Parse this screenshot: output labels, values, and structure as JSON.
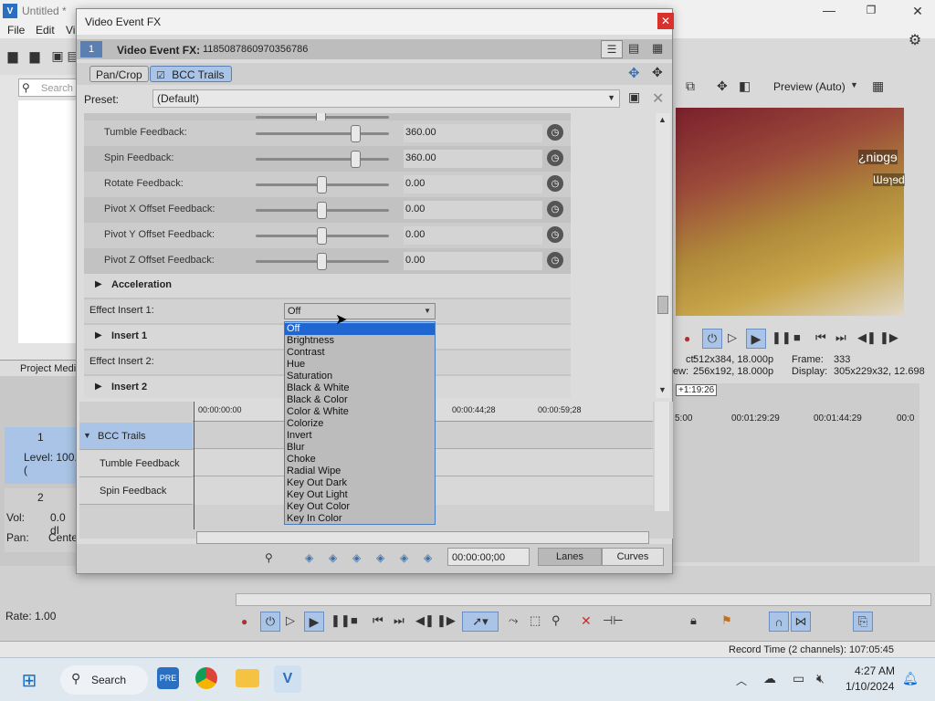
{
  "app": {
    "title": "Untitled *",
    "menu": [
      "File",
      "Edit",
      "Vi"
    ],
    "search_placeholder": "Search",
    "project_media_tab": "Project Medi",
    "track1": {
      "number": "1",
      "level": "Level: 100.("
    },
    "track2": {
      "number": "2",
      "vol_label": "Vol:",
      "vol_value": "0.0 dI",
      "pan_label": "Pan:",
      "pan_value": "Cente"
    },
    "rate": "Rate: 1.00",
    "record_time": "Record Time (2 channels): 107:05:45"
  },
  "preview": {
    "label": "Preview (Auto)",
    "overlay_text_1": "¿niɒgɘ",
    "overlay_text_2": "Ɯɘɿɘd",
    "project_label": "ct:",
    "project_value": "512x384, 18.000p",
    "frame_label": "Frame:",
    "frame_value": "333",
    "preview_label": "ew:",
    "preview_value": "256x192, 18.000p",
    "display_label": "Display:",
    "display_value": "305x229x32, 12.698",
    "timecode_badge": "+1:19:26",
    "ruler": [
      "5:00",
      "00:01:29:29",
      "00:01:44:29",
      "00:0"
    ]
  },
  "dialog": {
    "title": "Video Event FX",
    "header_index": "1",
    "header_text": "Video Event FX:",
    "header_id": "1185087860970356786",
    "chain": [
      "Pan/Crop",
      "BCC Trails"
    ],
    "preset_label": "Preset:",
    "preset_value": "(Default)",
    "params": [
      {
        "label": "Tumble Feedback:",
        "value": "360.00",
        "level": 0.75
      },
      {
        "label": "Spin Feedback:",
        "value": "360.00",
        "level": 0.75
      },
      {
        "label": "Rotate Feedback:",
        "value": "0.00",
        "level": 0.5
      },
      {
        "label": "Pivot X Offset Feedback:",
        "value": "0.00",
        "level": 0.5
      },
      {
        "label": "Pivot Y Offset Feedback:",
        "value": "0.00",
        "level": 0.5
      },
      {
        "label": "Pivot Z Offset Feedback:",
        "value": "0.00",
        "level": 0.5
      }
    ],
    "section_acceleration": "Acceleration",
    "effect_insert_1": "Effect Insert 1:",
    "section_insert_1": "Insert 1",
    "effect_insert_2": "Effect Insert 2:",
    "section_insert_2": "Insert 2",
    "dropdown_value": "Off",
    "dropdown_options": [
      "Off",
      "Brightness",
      "Contrast",
      "Hue",
      "Saturation",
      "Black & White",
      "Black & Color",
      "Color & White",
      "Colorize",
      "Invert",
      "Blur",
      "Choke",
      "Radial Wipe",
      "Key Out Dark",
      "Key Out Light",
      "Key Out Color",
      "Key In Color"
    ],
    "keyframes": {
      "ruler": [
        "00:00:00:00",
        "00:00:44;28",
        "00:00:59;28"
      ],
      "tracks": [
        "BCC Trails",
        "Tumble Feedback",
        "Spin Feedback"
      ],
      "timecode": "00:00:00;00",
      "lanes": "Lanes",
      "curves": "Curves"
    }
  },
  "taskbar": {
    "search": "Search",
    "time": "4:27 AM",
    "date": "1/10/2024"
  }
}
